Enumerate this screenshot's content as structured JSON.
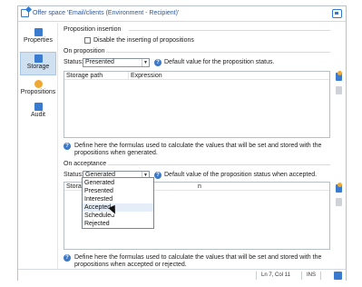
{
  "window": {
    "title": "Offer space 'Email/clients (Environment - Recipient)'"
  },
  "sidebar": {
    "items": [
      {
        "label": "Properties",
        "icon": "properties-icon",
        "color": "#3a7bd0",
        "selected": false
      },
      {
        "label": "Storage",
        "icon": "storage-icon",
        "color": "#3a7bd0",
        "selected": true
      },
      {
        "label": "Propositions",
        "icon": "propositions-icon",
        "color": "#f0a830",
        "selected": false
      },
      {
        "label": "Audit",
        "icon": "audit-icon",
        "color": "#3a7bd0",
        "selected": false
      }
    ]
  },
  "proposition_insertion": {
    "heading": "Proposition insertion",
    "checkbox_label": "Disable the inserting of propositions",
    "checked": false
  },
  "on_proposition": {
    "heading": "On proposition",
    "status_label": "Status:",
    "status_value": "Presented",
    "hint": "Default value for the proposition status.",
    "columns": [
      "Storage path",
      "Expression"
    ],
    "description": "Define here the formulas used to calculate the values that will be set and stored with the propositions when generated."
  },
  "on_acceptance": {
    "heading": "On acceptance",
    "status_label": "Status:",
    "status_value": "Generated",
    "hint": "Default value of the proposition status when accepted.",
    "columns_partial": [
      "Storage",
      "n"
    ],
    "description": "Define here the formulas used to calculate the values that will be set and stored with the propositions when accepted or rejected.",
    "dropdown_options": [
      "Generated",
      "Presented",
      "Interested",
      "Accepted",
      "Scheduled",
      "Rejected"
    ],
    "hovered_option": "Accepted"
  },
  "statusbar": {
    "position": "Ln 7, Col 11",
    "mode": "INS"
  },
  "colors": {
    "accent": "#2e7bd6",
    "title_text": "#2b579a",
    "selected_bg": "#cfe0f1",
    "help": "#3c78c8"
  }
}
